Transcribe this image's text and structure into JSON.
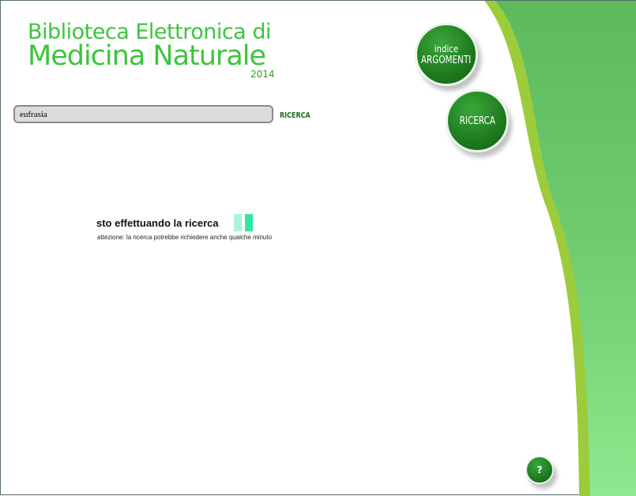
{
  "header": {
    "title_line1": "Biblioteca Elettronica di",
    "title_line2": "Medicina Naturale",
    "year": "2014"
  },
  "search": {
    "value": "eufrasia",
    "button_label": "RICERCA"
  },
  "nav": {
    "argomenti_line1": "indice",
    "argomenti_line2": "ARGOMENTI",
    "ricerca_label": "RICERCA",
    "help_label": "?"
  },
  "status": {
    "title": "sto effettuando la ricerca",
    "note": "attezione: la ricerca potrebbe richiedere anche qualche minuto"
  },
  "colors": {
    "brand_green": "#3dc43d",
    "button_green": "#1f7a1f",
    "panel_green": "#66c466",
    "spinner_light": "#aaf5d8",
    "spinner_dark": "#33e6a0"
  }
}
